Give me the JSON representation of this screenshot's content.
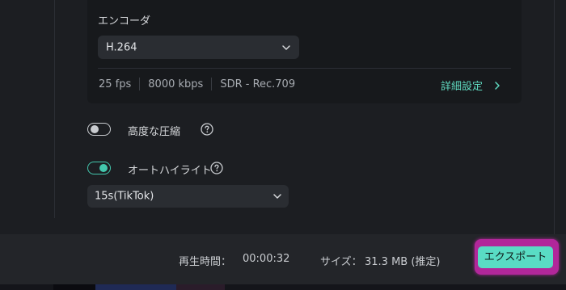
{
  "encoder": {
    "label": "エンコーダ",
    "value": "H.264",
    "specs": {
      "fps": "25 fps",
      "bitrate": "8000 kbps",
      "color": "SDR - Rec.709"
    },
    "advanced_link": "詳細設定"
  },
  "options": {
    "advanced_compression": {
      "label": "高度な圧縮",
      "enabled": false
    },
    "auto_highlight": {
      "label": "オートハイライト",
      "enabled": true,
      "select_value": "15s(TikTok)"
    }
  },
  "footer": {
    "duration_label": "再生時間：",
    "duration_value": "00:00:32",
    "size_label": "サイズ：",
    "size_value": "31.3 MB (推定)",
    "export_label": "エクスポート"
  },
  "colors": {
    "accent": "#5fd9bf",
    "export_button": "#59dcc4",
    "highlight_border": "#b1279a",
    "background": "#1c1e22"
  },
  "icons": [
    "chevron-down-icon",
    "chevron-right-icon",
    "help-icon"
  ]
}
